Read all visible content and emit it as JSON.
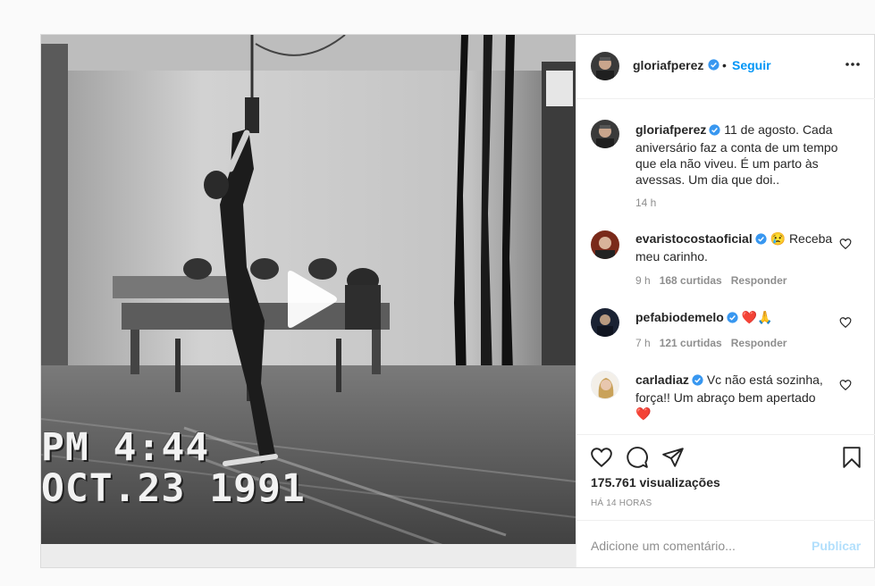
{
  "post": {
    "header": {
      "username": "gloriafperez",
      "separator": "•",
      "follow_label": "Seguir"
    },
    "caption": {
      "username": "gloriafperez",
      "text": "11 de agosto. Cada aniversário faz a conta de um tempo que ela não viveu. É um parto às avessas. Um dia que doi..",
      "time": "14 h"
    },
    "comments": [
      {
        "username": "evaristocostaoficial",
        "text": "😢 Receba meu carinho.",
        "time": "9 h",
        "likes": "168 curtidas",
        "reply": "Responder"
      },
      {
        "username": "pefabiodemelo",
        "text": "❤️🙏",
        "time": "7 h",
        "likes": "121 curtidas",
        "reply": "Responder"
      },
      {
        "username": "carladiaz",
        "text": "Vc não está sozinha, força!! Um abraço bem apertado ❤️"
      }
    ],
    "views": "175.761 visualizações",
    "posted_ago": "HÁ 14 HORAS",
    "add_comment_placeholder": "Adicione um comentário...",
    "publish_label": "Publicar",
    "video_timestamp": {
      "time": "PM 4:44",
      "date": "OCT.23 1991"
    }
  },
  "icons": [
    "more-options-icon",
    "verified-icon",
    "like-icon",
    "comment-icon",
    "share-icon",
    "save-icon",
    "play-icon"
  ],
  "colors": {
    "link_blue": "#0095f6",
    "disabled_blue": "#b2dffc",
    "verified_blue": "#3897f0",
    "muted": "#8e8e8e"
  }
}
